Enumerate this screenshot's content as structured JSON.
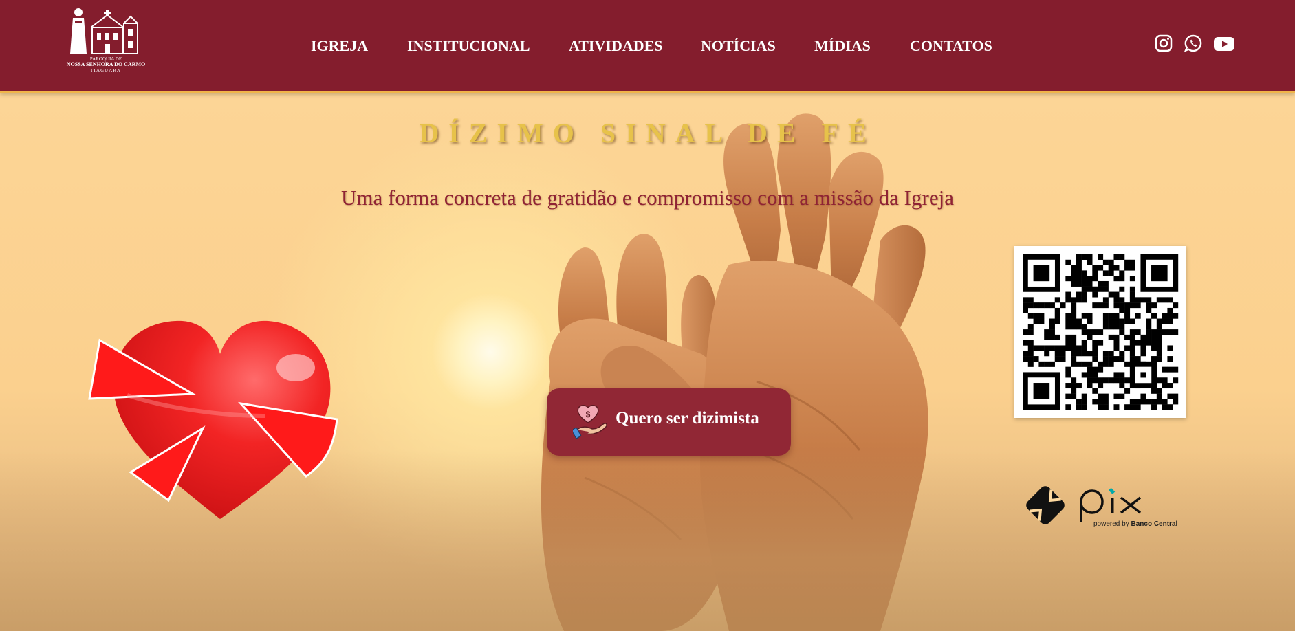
{
  "header": {
    "logo": {
      "line1": "PAROQUIA DE",
      "line2": "NOSSA SENHORA DO CARMO",
      "line3": "ITAGUARA"
    },
    "nav": [
      "IGREJA",
      "INSTITUCIONAL",
      "ATIVIDADES",
      "NOTÍCIAS",
      "MÍDIAS",
      "CONTATOS"
    ],
    "social": [
      "instagram-icon",
      "whatsapp-icon",
      "youtube-icon"
    ]
  },
  "hero": {
    "title": "DÍZIMO SINAL DE FÉ",
    "subtitle": "Uma forma concreta de gratidão e compromisso com a missão da Igreja",
    "cta_label": "Quero ser dizimista",
    "pix": {
      "wordmark": "pix",
      "caption_prefix": "powered by",
      "caption_brand": "Banco Central"
    }
  },
  "colors": {
    "header_bg": "#841d2d",
    "accent_gold": "#e7c24a",
    "button_bg": "#912735",
    "subtitle": "#8f2334"
  }
}
